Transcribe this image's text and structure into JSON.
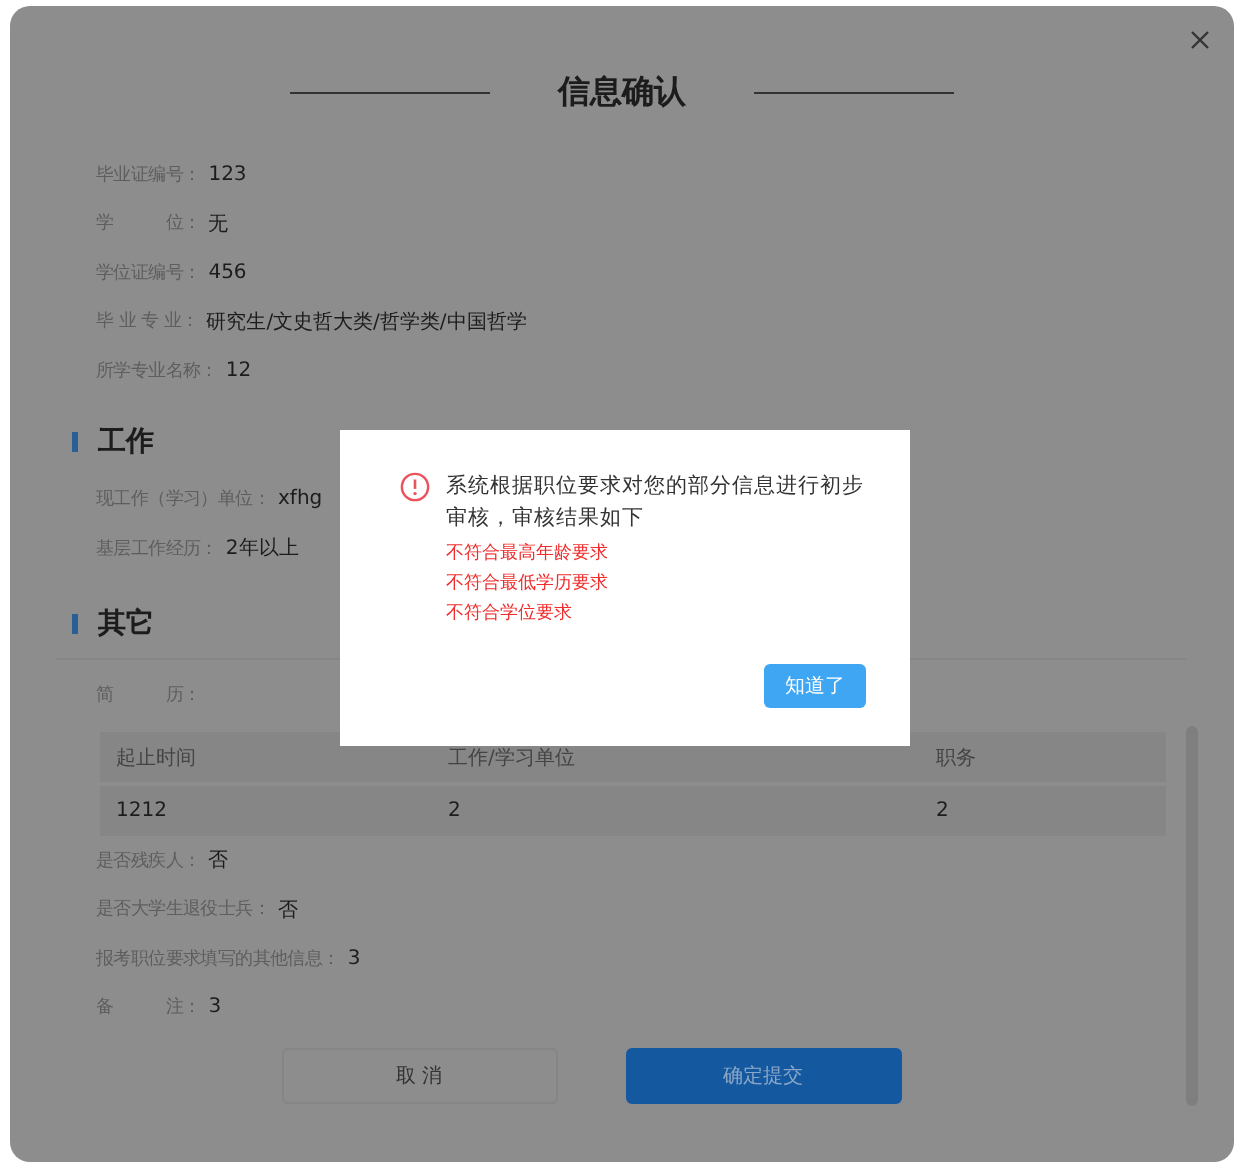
{
  "dialog": {
    "title": "信息确认"
  },
  "education": [
    {
      "label": "毕业证编号：",
      "value": "123"
    },
    {
      "label": "学　　　位：",
      "value": "无"
    },
    {
      "label": "学位证编号：",
      "value": "456"
    },
    {
      "label": "毕 业 专 业：",
      "value": "研究生/文史哲大类/哲学类/中国哲学"
    },
    {
      "label": "所学专业名称：",
      "value": "12"
    }
  ],
  "work": {
    "title": "工作",
    "fields": [
      {
        "label": "现工作（学习）单位：",
        "value": "xfhg"
      },
      {
        "label": "基层工作经历：",
        "value": "2年以上"
      }
    ]
  },
  "other": {
    "title": "其它",
    "resume_label": "简　　　历：",
    "table": {
      "columns": [
        "起止时间",
        "工作/学习单位",
        "职务"
      ],
      "rows": [
        [
          "1212",
          "2",
          "2"
        ]
      ]
    },
    "fields": [
      {
        "label": "是否残疾人：",
        "value": "否"
      },
      {
        "label": "是否大学生退役士兵：",
        "value": "否"
      },
      {
        "label": "报考职位要求填写的其他信息：",
        "value": "3"
      },
      {
        "label": "备　　　注：",
        "value": "3"
      }
    ]
  },
  "buttons": [
    {
      "label": "取 消",
      "kind": "secondary"
    },
    {
      "label": "确定提交",
      "kind": "primary"
    }
  ],
  "alert": {
    "message": "系统根据职位要求对您的部分信息进行初步审核，审核结果如下",
    "issues": [
      "不符合最高年龄要求",
      "不符合最低学历要求",
      "不符合学位要求"
    ],
    "button": "知道了"
  }
}
